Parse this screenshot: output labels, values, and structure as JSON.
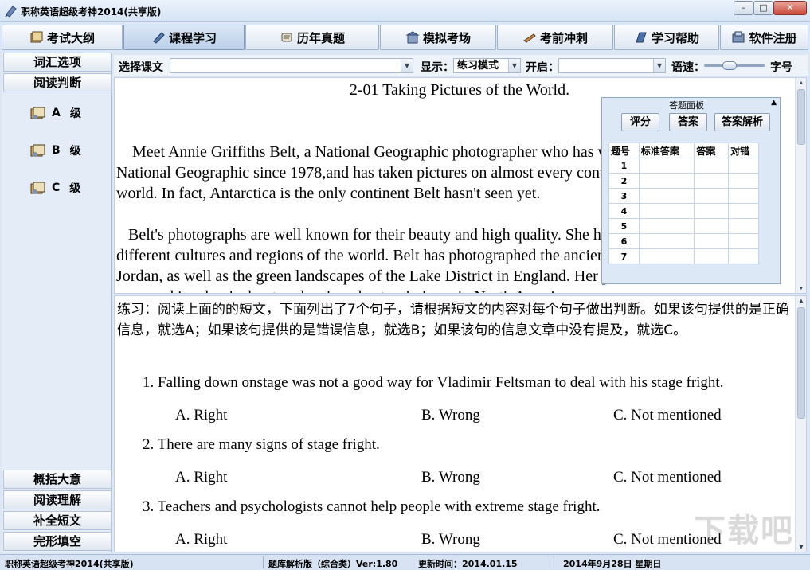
{
  "window": {
    "title": "职称英语超级考神2014(共享版)",
    "controls": {
      "minimize": "–",
      "maximize": "□",
      "close": "✕"
    }
  },
  "toolbar": {
    "items": [
      {
        "label": "考试大纲",
        "icon": "book-icon"
      },
      {
        "label": "课程学习",
        "icon": "pen-icon",
        "active": true
      },
      {
        "label": "历年真题",
        "icon": "scroll-icon"
      },
      {
        "label": "模拟考场",
        "icon": "building-icon"
      },
      {
        "label": "考前冲刺",
        "icon": "rocket-icon"
      },
      {
        "label": "学习帮助",
        "icon": "help-book-icon"
      },
      {
        "label": "软件注册",
        "icon": "register-icon"
      }
    ]
  },
  "sidebar": {
    "top_items": [
      "词汇选项",
      "阅读判断"
    ],
    "levels": [
      {
        "letter": "A",
        "suffix": "级"
      },
      {
        "letter": "B",
        "suffix": "级"
      },
      {
        "letter": "C",
        "suffix": "级"
      }
    ],
    "bottom_items": [
      "概括大意",
      "阅读理解",
      "补全短文",
      "完形填空"
    ]
  },
  "selbar": {
    "select_text_label": "选择课文",
    "select_text_value": "",
    "display_label": "显示：",
    "display_value": "练习模式",
    "open_label": "开启：",
    "open_value": "",
    "speed_label": "语速：",
    "speed_level": 0.4,
    "font_label": "字号"
  },
  "reading": {
    "title": "2-01 Taking Pictures of the World.",
    "paragraphs": [
      "    Meet Annie Griffiths Belt, a National Geographic photographer who has worked for\nNational Geographic since 1978,and has taken pictures on almost every continent of the\nworld. In fact, Antarctica is the only continent Belt hasn't seen yet.",
      "   Belt's photographs are well known for their beauty and high quality. She has captured other\ndifferent cultures and regions of the world. Belt has photographed the ancient city of Petra,\nJordan, as well as the green landscapes of the Lake District in England. Her pictures also\nappeared in a book about undeveloped natural places in North America."
    ]
  },
  "answer_panel": {
    "title": "答题面板",
    "buttons": [
      "评分",
      "答案",
      "答案解析"
    ],
    "headers": [
      "题号",
      "标准答案",
      "答案",
      "对错"
    ],
    "rows": [
      "1",
      "2",
      "3",
      "4",
      "5",
      "6",
      "7"
    ]
  },
  "practice": {
    "instruction": "练习：阅读上面的的短文，下面列出了7个句子，请根据短文的内容对每个句子做出判断。如果该句提供的是正确信息，就选A；如果该句提供的是错误信息，就选B；如果该句的信息文章中没有提及，就选C。",
    "questions": [
      {
        "text": "1. Falling down onstage was not a good way for Vladimir Feltsman to deal with his stage fright.",
        "options": [
          "A. Right",
          "B. Wrong",
          "C. Not mentioned"
        ]
      },
      {
        "text": "2. There are many signs of stage fright.",
        "options": [
          "A. Right",
          "B. Wrong",
          "C. Not mentioned"
        ]
      },
      {
        "text": "3. Teachers and psychologists cannot help people with extreme stage fright.",
        "options": [
          "A. Right",
          "B. Wrong",
          "C. Not mentioned"
        ]
      }
    ]
  },
  "statusbar": {
    "app": "职称英语超级考神2014(共享版)",
    "edition": "题库解析版（综合类）Ver:1.80",
    "updated": "更新时间：2014.01.15",
    "date": "2014年9月28日  星期日"
  },
  "watermark": "下载吧"
}
